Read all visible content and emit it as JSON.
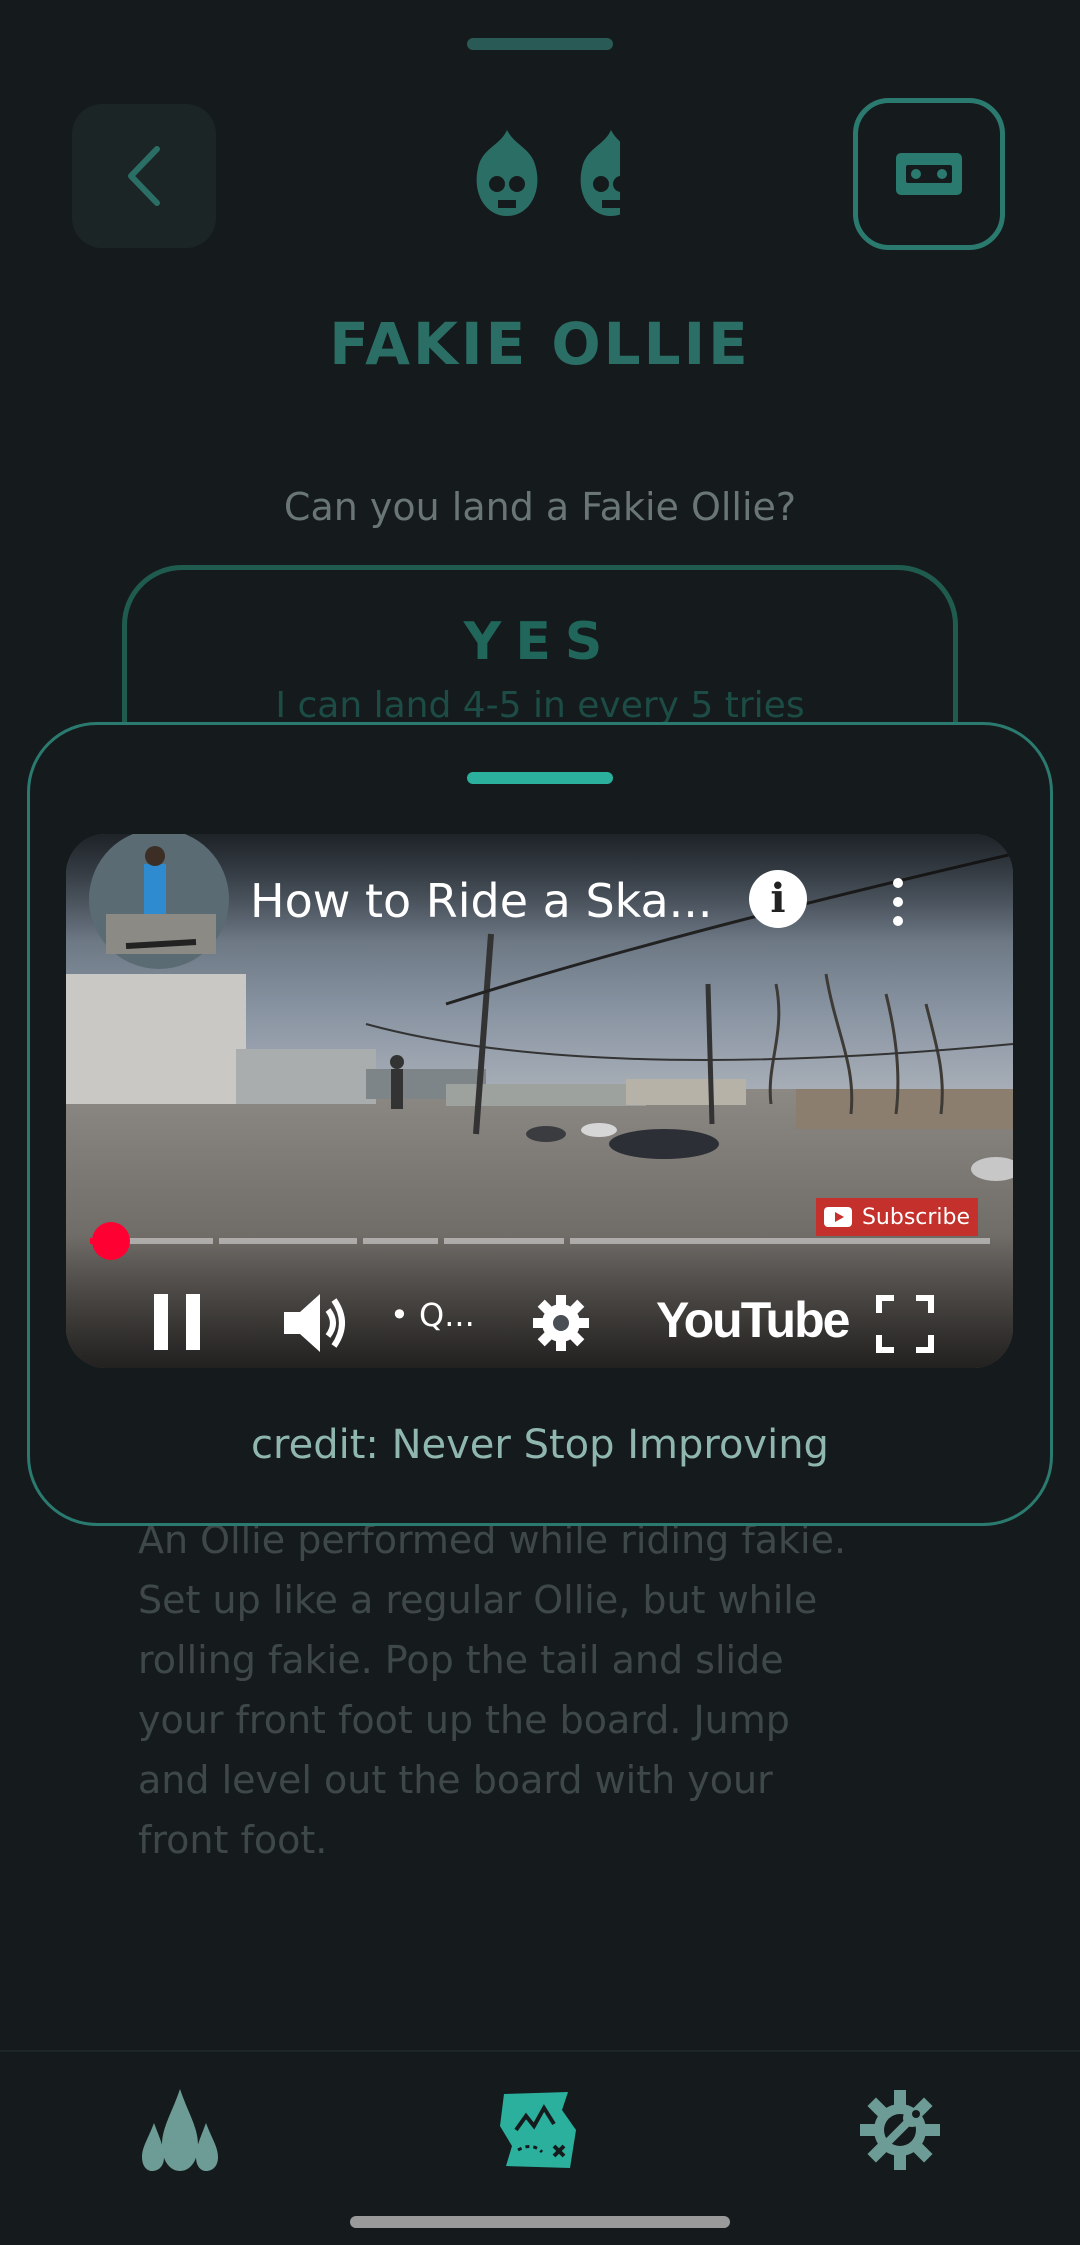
{
  "colors": {
    "background": "#151b1c",
    "accent": "#2b7a70",
    "accent_bright": "#2bb09e",
    "youtube_red": "#ff0033"
  },
  "header": {
    "back_icon": "chevron-left-icon",
    "flame_icons": [
      "flaming-skull-icon",
      "flaming-skull-icon"
    ],
    "video_icon": "vhs-tape-icon"
  },
  "trick": {
    "title": "FAKIE OLLIE",
    "question": "Can you land a Fakie Ollie?",
    "answer_label": "YES",
    "answer_sub": "I can land 4-5 in every 5 tries",
    "description_lines": [
      "An Ollie performed while riding fakie.",
      "Set up like a regular Ollie, but while",
      "rolling fakie. Pop the tail and slide",
      "your front foot up the board. Jump",
      "and level out the board with your",
      "front foot."
    ]
  },
  "video_sheet": {
    "video": {
      "title": "How to Ride a Ska...",
      "info_label": "i",
      "subscribe_label": "Subscribe",
      "quality_label": "• Q...",
      "brand_label": "YouTube",
      "progress_fraction": 0.03,
      "chapter_bounds": [
        0.14,
        0.3,
        0.39,
        0.53
      ],
      "icons": [
        "pause-icon",
        "volume-icon",
        "settings-gear-icon",
        "fullscreen-icon",
        "more-vert-icon"
      ]
    },
    "credit": "credit: Never Stop Improving"
  },
  "bottom_nav": {
    "items": [
      {
        "icon": "water-drops-icon"
      },
      {
        "icon": "treasure-map-icon"
      },
      {
        "icon": "gear-wrench-icon"
      }
    ]
  }
}
